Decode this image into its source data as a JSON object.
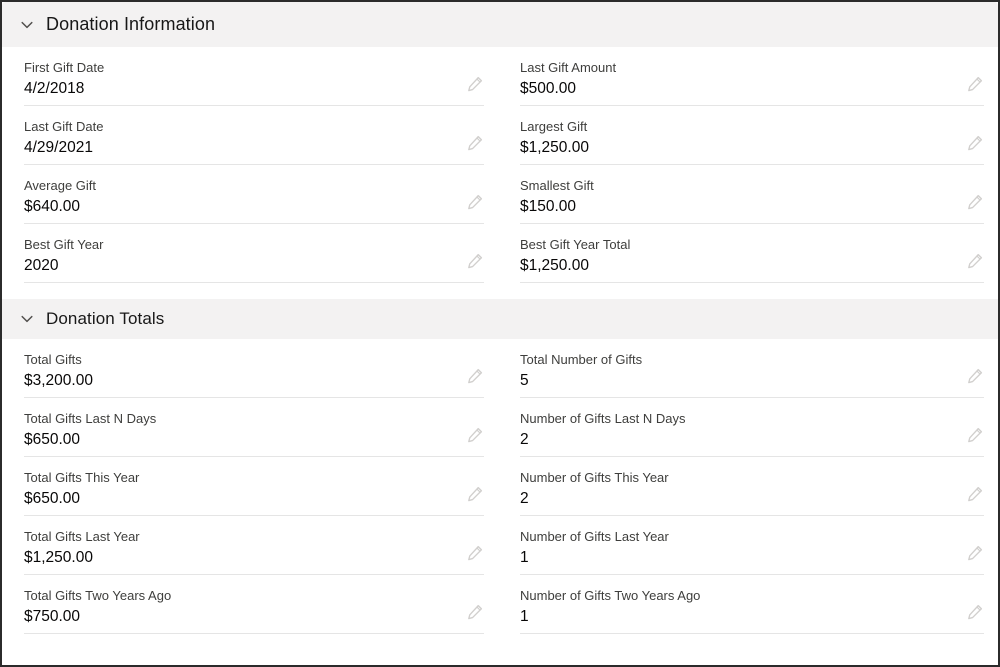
{
  "sections": [
    {
      "id": "donation-information",
      "title": "Donation Information",
      "collapse_icon": "chevron-down-icon",
      "left_fields": [
        {
          "label": "First Gift Date",
          "value": "4/2/2018",
          "edit_icon": "pencil-icon"
        },
        {
          "label": "Last Gift Date",
          "value": "4/29/2021",
          "edit_icon": "pencil-icon"
        },
        {
          "label": "Average Gift",
          "value": "$640.00",
          "edit_icon": "pencil-icon"
        },
        {
          "label": "Best Gift Year",
          "value": "2020",
          "edit_icon": "pencil-icon"
        }
      ],
      "right_fields": [
        {
          "label": "Last Gift Amount",
          "value": "$500.00",
          "edit_icon": "pencil-icon"
        },
        {
          "label": "Largest Gift",
          "value": "$1,250.00",
          "edit_icon": "pencil-icon"
        },
        {
          "label": "Smallest Gift",
          "value": "$150.00",
          "edit_icon": "pencil-icon"
        },
        {
          "label": "Best Gift Year Total",
          "value": "$1,250.00",
          "edit_icon": "pencil-icon"
        }
      ]
    },
    {
      "id": "donation-totals",
      "title": "Donation Totals",
      "collapse_icon": "chevron-down-icon",
      "left_fields": [
        {
          "label": "Total Gifts",
          "value": "$3,200.00",
          "edit_icon": "pencil-icon"
        },
        {
          "label": "Total Gifts Last N Days",
          "value": "$650.00",
          "edit_icon": "pencil-icon"
        },
        {
          "label": "Total Gifts This Year",
          "value": "$650.00",
          "edit_icon": "pencil-icon"
        },
        {
          "label": "Total Gifts Last Year",
          "value": "$1,250.00",
          "edit_icon": "pencil-icon"
        },
        {
          "label": "Total Gifts Two Years Ago",
          "value": "$750.00",
          "edit_icon": "pencil-icon"
        }
      ],
      "right_fields": [
        {
          "label": "Total Number of Gifts",
          "value": "5",
          "edit_icon": "pencil-icon"
        },
        {
          "label": "Number of Gifts Last N Days",
          "value": "2",
          "edit_icon": "pencil-icon"
        },
        {
          "label": "Number of Gifts This Year",
          "value": "2",
          "edit_icon": "pencil-icon"
        },
        {
          "label": "Number of Gifts Last Year",
          "value": "1",
          "edit_icon": "pencil-icon"
        },
        {
          "label": "Number of Gifts Two Years Ago",
          "value": "1",
          "edit_icon": "pencil-icon"
        }
      ]
    }
  ],
  "colors": {
    "header_band": "#f3f2f2",
    "field_divider": "#e5e5e5",
    "label_text": "#3e3e3c",
    "value_text": "#080707",
    "edit_icon": "#c9c7c5",
    "page_border": "#2b2b2b"
  }
}
